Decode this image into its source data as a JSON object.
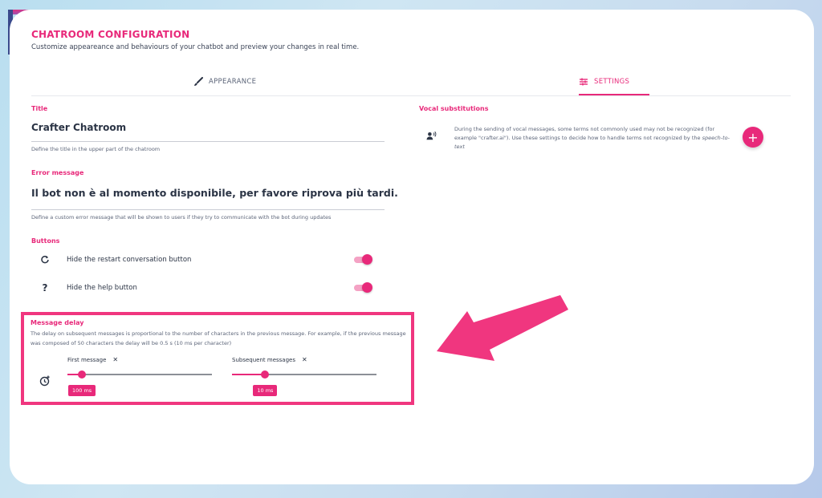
{
  "header": {
    "title": "CHATROOM CONFIGURATION",
    "subtitle": "Customize appeareance and behaviours of your chatbot and preview your changes in real time."
  },
  "tabs": [
    {
      "label": "APPEARANCE",
      "icon": "brush-icon",
      "active": false
    },
    {
      "label": "SETTINGS",
      "icon": "sliders-icon",
      "active": true
    }
  ],
  "title_field": {
    "label": "Title",
    "value": "Crafter Chatroom",
    "hint": "Define the title in the upper part of the chatroom"
  },
  "error_field": {
    "label": "Error message",
    "value": "Il bot non è al momento disponibile, per favore riprova più tardi.",
    "hint": "Define a custom error message that will be shown to users if they try to communicate with the bot during updates"
  },
  "buttons": {
    "label": "Buttons",
    "items": [
      {
        "label": "Hide the restart conversation button",
        "icon": "restart-icon",
        "enabled": true
      },
      {
        "label": "Hide the help button",
        "icon": "help-icon",
        "enabled": true
      }
    ]
  },
  "message_delay": {
    "label": "Message delay",
    "description": "The delay on subsequent messages is proportional to the number of characters in the previous message. For example, if the previous message was composed of 50 characters the delay will be 0.5 s (10 ms per character)",
    "icon": "timer-add-icon",
    "first": {
      "label": "First message",
      "value_text": "100 ms",
      "fraction": 0.1
    },
    "subsequent": {
      "label": "Subsequent messages",
      "value_text": "10 ms",
      "fraction": 0.23
    }
  },
  "vocal": {
    "label": "Vocal substitutions",
    "icon": "voice-user-icon",
    "text_before": "During the sending of vocal messages, some terms not commonly used may not be recognized (for example \"crafter.ai\"). Use these settings to decide how to handle terms not recognized by the ",
    "text_emph": "speech-to-text",
    "add_label": "+"
  },
  "colors": {
    "accent": "#e8297a",
    "text": "#2b3445"
  }
}
